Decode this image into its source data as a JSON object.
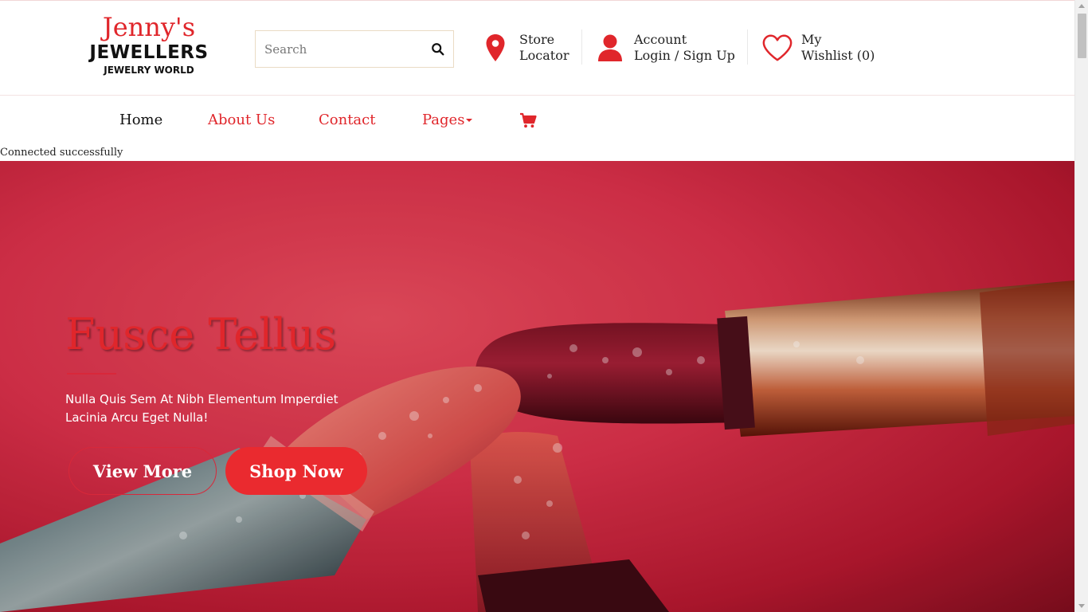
{
  "logo": {
    "line1": "Jenny's",
    "line2": "JEWELLERS",
    "line3": "JEWELRY WORLD"
  },
  "search": {
    "placeholder": "Search",
    "value": "",
    "icon": "search-icon"
  },
  "header": {
    "store": {
      "line1": "Store",
      "line2": "Locator",
      "icon": "map-pin-icon"
    },
    "account": {
      "line1": "Account",
      "line2": "Login / Sign Up",
      "icon": "user-icon"
    },
    "wishlist": {
      "line1": "My",
      "line2": "Wishlist (0)",
      "icon": "heart-icon"
    }
  },
  "nav": {
    "items": [
      {
        "label": "Home",
        "active": true
      },
      {
        "label": "About Us",
        "active": false
      },
      {
        "label": "Contact",
        "active": false
      },
      {
        "label": "Pages",
        "active": false,
        "dropdown": true
      }
    ],
    "cart_icon": "cart-icon"
  },
  "status_text": "Connected successfully",
  "hero": {
    "title": "Fusce Tellus",
    "subtitle": "Nulla Quis Sem At Nibh Elementum Imperdiet Lacinia Arcu Eget Nulla!",
    "btn_view": "View More",
    "btn_shop": "Shop Now"
  },
  "colors": {
    "accent": "#e0262b",
    "button": "#ea2a2f",
    "text": "#222222"
  }
}
